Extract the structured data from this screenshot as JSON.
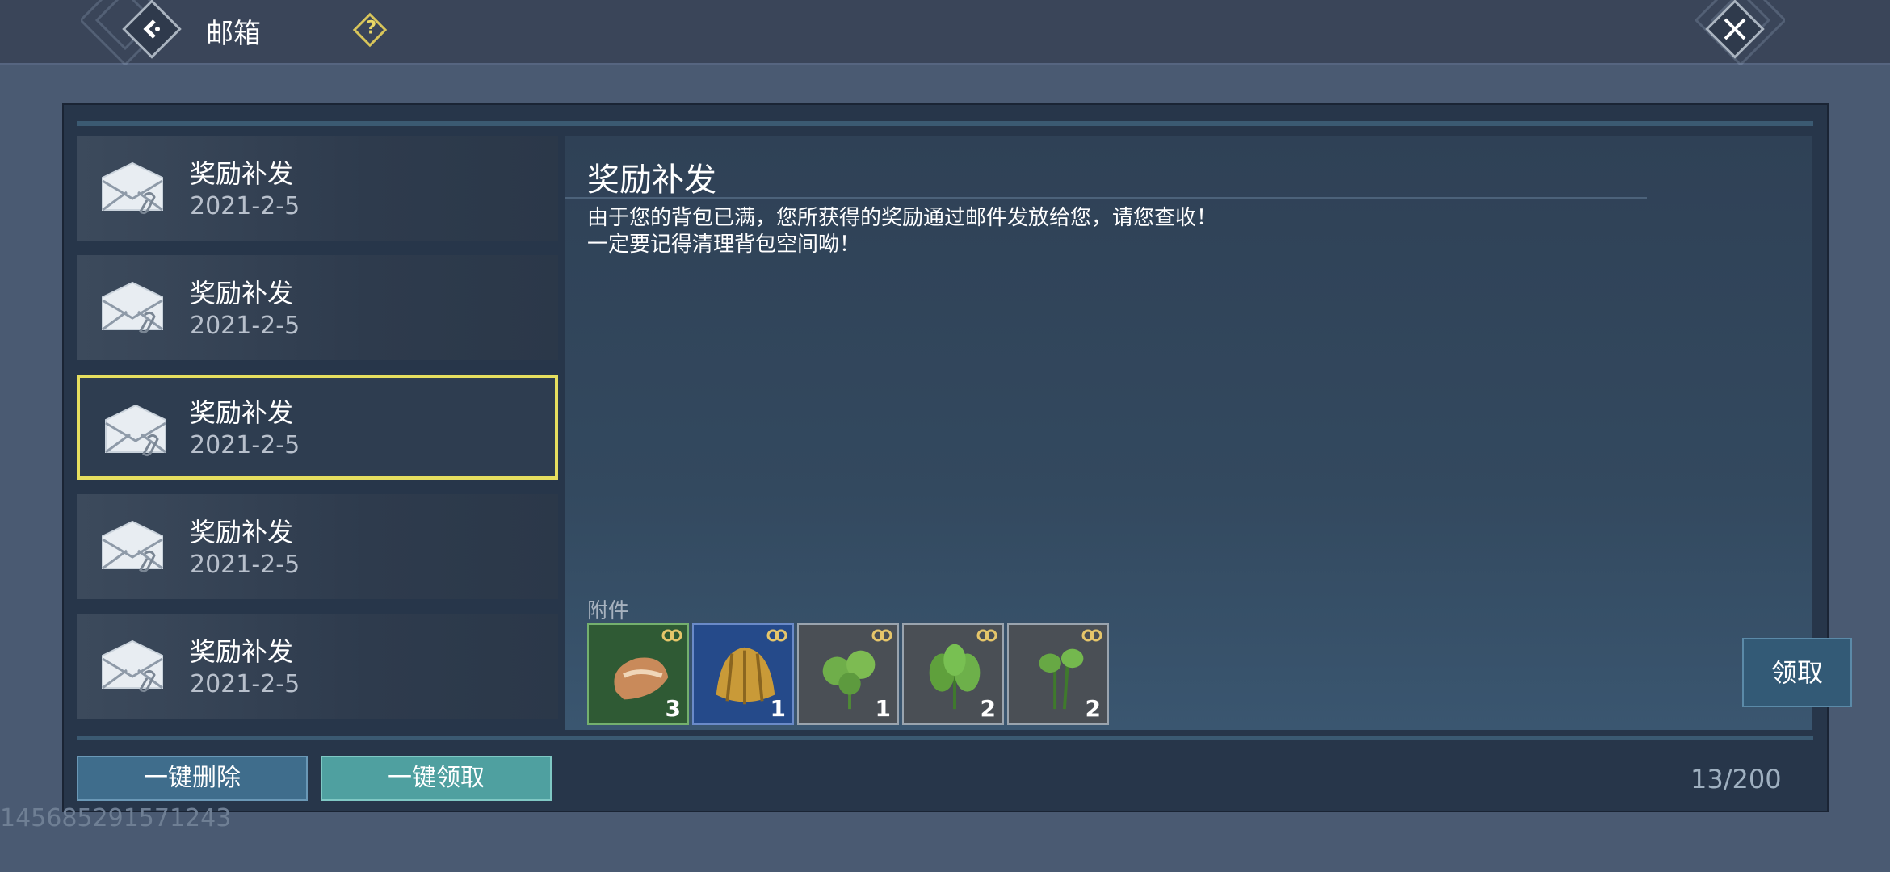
{
  "header": {
    "title": "邮箱",
    "help_symbol": "?"
  },
  "mail_list": [
    {
      "title": "奖励补发",
      "date": "2021-2-5",
      "selected": false
    },
    {
      "title": "奖励补发",
      "date": "2021-2-5",
      "selected": false
    },
    {
      "title": "奖励补发",
      "date": "2021-2-5",
      "selected": true
    },
    {
      "title": "奖励补发",
      "date": "2021-2-5",
      "selected": false
    },
    {
      "title": "奖励补发",
      "date": "2021-2-5",
      "selected": false
    }
  ],
  "detail": {
    "title": "奖励补发",
    "body_line1": "由于您的背包已满，您所获得的奖励通过邮件发放给您，请您查收！",
    "body_line2": "一定要记得清理背包空间呦！",
    "attachments_label": "附件",
    "attachments": [
      {
        "item": "shellfish-icon",
        "count": "3",
        "rarity": "green"
      },
      {
        "item": "scallop-shell-icon",
        "count": "1",
        "rarity": "blue"
      },
      {
        "item": "herb-leaf-icon",
        "count": "1",
        "rarity": "gray"
      },
      {
        "item": "spinach-icon",
        "count": "2",
        "rarity": "gray"
      },
      {
        "item": "water-spinach-icon",
        "count": "2",
        "rarity": "gray"
      }
    ],
    "claim_label": "领取"
  },
  "footer": {
    "delete_all_label": "一键删除",
    "claim_all_label": "一键领取",
    "mail_count": "13/200"
  },
  "uid": "145685291571243",
  "colors": {
    "selected_border": "#e6df5f",
    "claim_all_button": "#4fa0a0",
    "delete_all_button": "#3f6d8c"
  }
}
